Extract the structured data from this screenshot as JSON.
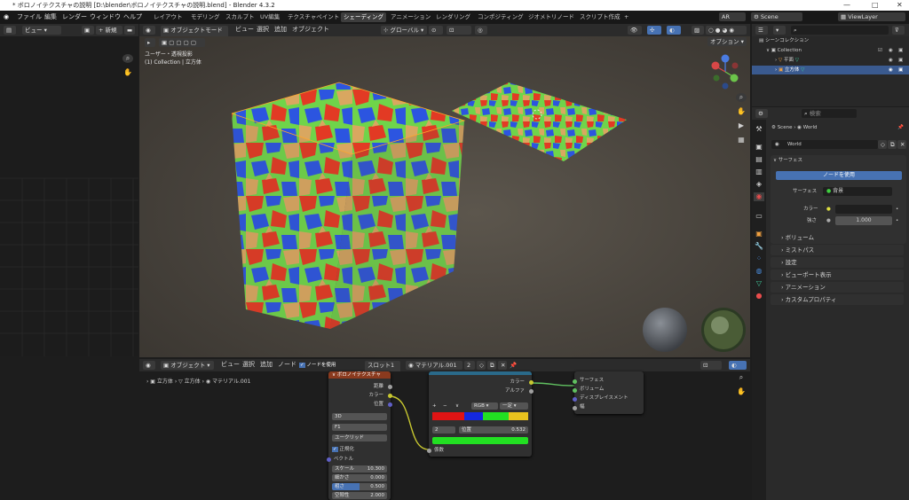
{
  "window": {
    "title": "* ボロノイテクスチャの説明 [D:\\blender\\ボロノイテクスチャの説明.blend] - Blender 4.3.2"
  },
  "menu": [
    "ファイル",
    "編集",
    "レンダー",
    "ウィンドウ",
    "ヘルプ"
  ],
  "workspaces": [
    "レイアウト",
    "モデリング",
    "スカルプト",
    "UV編集",
    "テクスチャペイント",
    "シェーディング",
    "アニメーション",
    "レンダリング",
    "コンポジティング",
    "ジオメトリノード",
    "スクリプト作成",
    "+"
  ],
  "active_workspace": "シェーディング",
  "topright": {
    "scene_label": "Scene",
    "viewlayer_label": "ViewLayer",
    "ar_label": "AR"
  },
  "left_header": {
    "view_label": "ビュー",
    "new_label": "新規"
  },
  "viewport": {
    "mode": "オブジェクトモード",
    "menus": [
      "ビュー",
      "選択",
      "追加",
      "オブジェクト"
    ],
    "transform": "グローバル",
    "options": "オプション",
    "overlay_line1": "ユーザー・透視投影",
    "overlay_line2": "(1) Collection | 立方体"
  },
  "outliner": {
    "scene_collection": "シーンコレクション",
    "collection": "Collection",
    "items": [
      "平面",
      "立方体"
    ]
  },
  "properties": {
    "search_placeholder": "検索",
    "breadcrumb_scene": "Scene",
    "breadcrumb_world": "World",
    "world_name": "World",
    "surface_header": "サーフェス",
    "use_nodes": "ノードを使用",
    "surface_label": "サーフェス",
    "surface_value": "背景",
    "color_label": "カラー",
    "strength_label": "強さ",
    "strength_value": "1.000",
    "sections": [
      "ボリューム",
      "ミストパス",
      "設定",
      "ビューポート表示",
      "アニメーション",
      "カスタムプロパティ"
    ]
  },
  "node_editor": {
    "header_object": "オブジェクト",
    "menus": [
      "ビュー",
      "選択",
      "追加",
      "ノード"
    ],
    "use_nodes": "ノードを使用",
    "slot": "スロット1",
    "material": "マテリアル.001",
    "users": "2",
    "breadcrumb": [
      "立方体",
      "立方体",
      "マテリアル.001"
    ],
    "voronoi": {
      "title": "ボロノイテクスチャ",
      "outputs": [
        "距離",
        "カラー",
        "位置"
      ],
      "dims": "3D",
      "feature": "F1",
      "metric": "ユークリッド",
      "normalize": "正規化",
      "vector": "ベクトル",
      "scale_label": "スケール",
      "scale_value": "10.300",
      "detail_label": "細かさ",
      "detail_value": "0.000",
      "rough_label": "粗さ",
      "rough_value": "0.500",
      "lacunarity_label": "空隙性",
      "lacunarity_value": "2.000"
    },
    "ramp": {
      "outputs": [
        "カラー",
        "アルファ"
      ],
      "mode": "RGB",
      "interp": "一定",
      "index": "2",
      "pos_label": "位置",
      "pos_value": "0.532",
      "input": "係数",
      "stop_colors": [
        "#e01414",
        "#1428e0",
        "#22e022",
        "#e8c21e"
      ]
    },
    "output": {
      "inputs": [
        "サーフェス",
        "ボリューム",
        "ディスプレイスメント",
        "幅"
      ]
    }
  },
  "colors": {
    "accent": "#4772b3",
    "voronoi_header": "#8a3a1e",
    "ramp_header": "#2a6a8a"
  }
}
